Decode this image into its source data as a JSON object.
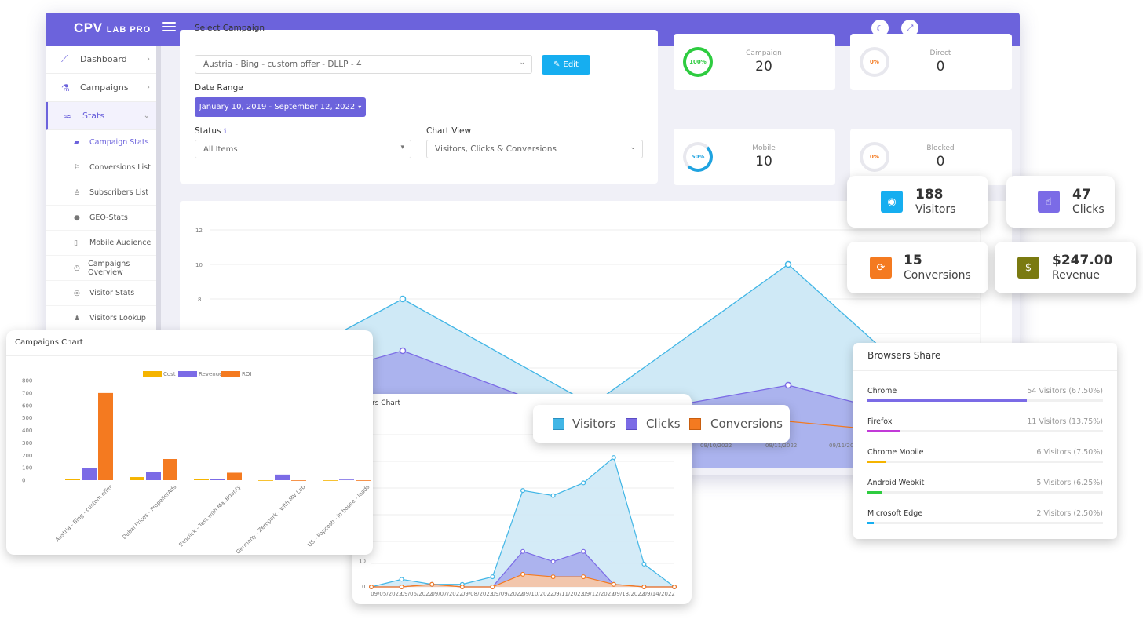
{
  "app": {
    "logo_main": "CPV",
    "logo_sub": "LAB PRO"
  },
  "sidebar": {
    "items": [
      {
        "label": "Dashboard",
        "icon": "chart-line-icon"
      },
      {
        "label": "Campaigns",
        "icon": "flask-icon"
      },
      {
        "label": "Stats",
        "icon": "stats-icon"
      }
    ],
    "subitems": [
      {
        "label": "Campaign Stats",
        "icon": "area-chart-icon"
      },
      {
        "label": "Conversions List",
        "icon": "flag-icon"
      },
      {
        "label": "Subscribers List",
        "icon": "user-icon"
      },
      {
        "label": "GEO-Stats",
        "icon": "globe-icon"
      },
      {
        "label": "Mobile Audience",
        "icon": "mobile-icon"
      },
      {
        "label": "Campaigns Overview",
        "icon": "clock-icon"
      },
      {
        "label": "Visitor Stats",
        "icon": "eye-icon"
      },
      {
        "label": "Visitors Lookup",
        "icon": "users-icon"
      }
    ]
  },
  "form": {
    "select_campaign_label": "Select Campaign",
    "campaign_value": "Austria - Bing - custom offer  -  DLLP  -  4",
    "edit_label": "Edit",
    "date_range_label": "Date Range",
    "date_range_value": "January 10, 2019 - September 12, 2022",
    "status_label": "Status",
    "status_value": "All Items",
    "chart_view_label": "Chart View",
    "chart_view_value": "Visitors, Clicks & Conversions"
  },
  "stat_cards": [
    {
      "label": "Campaign",
      "value": "20",
      "ring": "100%",
      "percent": 100,
      "color": "#2ecc40"
    },
    {
      "label": "Direct",
      "value": "0",
      "ring": "0%",
      "percent": 0,
      "color": "#e6e6ec"
    },
    {
      "label": "Mobile",
      "value": "10",
      "ring": "50%",
      "percent": 50,
      "color": "#1fa3e0"
    },
    {
      "label": "Blocked",
      "value": "0",
      "ring": "0%",
      "percent": 0,
      "color": "#e6e6ec"
    }
  ],
  "kpis": [
    {
      "value": "188",
      "label": "Visitors",
      "color": "#16aef0",
      "icon": "eye-icon"
    },
    {
      "value": "47",
      "label": "Clicks",
      "color": "#7b6be6",
      "icon": "hand-pointer-icon"
    },
    {
      "value": "15",
      "label": "Conversions",
      "color": "#f47a20",
      "icon": "refresh-icon"
    },
    {
      "value": "$247.00",
      "label": "Revenue",
      "color": "#7a7a10",
      "icon": "dollar-icon"
    }
  ],
  "legend": {
    "visitors": "Visitors",
    "clicks": "Clicks",
    "conversions": "Conversions"
  },
  "main_chart": {
    "y_ticks": [
      "12",
      "10",
      "8"
    ],
    "x_ticks": [
      "09/10/2022",
      "09/11/2022",
      "09/11/20"
    ]
  },
  "campaigns_chart": {
    "title": "Campaigns Chart",
    "legend": [
      "Cost",
      "Revenue",
      "ROI"
    ]
  },
  "visitors_chart": {
    "title_fragment": "tors Chart"
  },
  "browsers": {
    "title": "Browsers Share",
    "items": [
      {
        "name": "Chrome",
        "value": "54 Visitors (67.50%)",
        "pct": 67.5,
        "color": "#7b6be6"
      },
      {
        "name": "Firefox",
        "value": "11 Visitors (13.75%)",
        "pct": 13.75,
        "color": "#c23ad8"
      },
      {
        "name": "Chrome Mobile",
        "value": "6 Visitors (7.50%)",
        "pct": 7.5,
        "color": "#f5b400"
      },
      {
        "name": "Android Webkit",
        "value": "5 Visitors (6.25%)",
        "pct": 6.25,
        "color": "#2ecc40"
      },
      {
        "name": "Microsoft Edge",
        "value": "2 Visitors (2.50%)",
        "pct": 2.5,
        "color": "#16aef0"
      }
    ]
  },
  "chart_data": [
    {
      "type": "bar",
      "title": "Campaigns Chart",
      "categories": [
        "Austria - Bing - custom offer",
        "Dubai Prices - PropellerAds",
        "Exoclick - Test with MaxBounty",
        "Germany - Zeropark - with MV Lab",
        "US - Popcash - in house - leads"
      ],
      "series": [
        {
          "name": "Cost",
          "values": [
            10,
            25,
            10,
            0,
            0
          ],
          "color": "#f5b400"
        },
        {
          "name": "Revenue",
          "values": [
            100,
            65,
            10,
            45,
            5
          ],
          "color": "#7b6be6"
        },
        {
          "name": "ROI",
          "values": [
            700,
            170,
            60,
            0,
            0
          ],
          "color": "#f47a20"
        }
      ],
      "y_ticks": [
        800,
        700,
        600,
        500,
        400,
        300,
        200,
        100,
        0
      ],
      "ylim": [
        0,
        800
      ]
    },
    {
      "type": "area",
      "x": [
        "09/05/2022",
        "09/06/2022",
        "09/07/2022",
        "09/08/2022",
        "09/09/2022",
        "09/10/2022",
        "09/11/2022",
        "09/12/2022",
        "09/13/2022",
        "09/14/2022"
      ],
      "series": [
        {
          "name": "Visitors",
          "values": [
            0,
            3,
            1,
            1,
            4,
            38,
            36,
            41,
            51,
            9,
            0
          ],
          "color": "#41b6e6"
        },
        {
          "name": "Clicks",
          "values": [
            0,
            0,
            1,
            0,
            0,
            14,
            10,
            14,
            1,
            0,
            0
          ],
          "color": "#7b6be6"
        },
        {
          "name": "Conversions",
          "values": [
            0,
            0,
            1,
            0,
            0,
            5,
            4,
            4,
            1,
            0,
            0
          ],
          "color": "#f47a20"
        }
      ],
      "y_ticks": [
        "10",
        "0"
      ],
      "ylim": [
        0,
        60
      ]
    }
  ]
}
